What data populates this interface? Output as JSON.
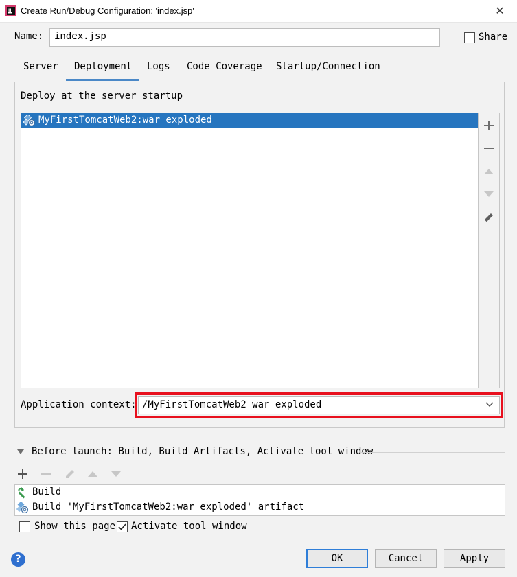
{
  "window": {
    "title": "Create Run/Debug Configuration: 'index.jsp'",
    "close_glyph": "✕"
  },
  "name_row": {
    "label": "Name:",
    "value": "index.jsp",
    "share_label": "Share",
    "share_checked": false
  },
  "tabs": [
    {
      "label": "Server",
      "active": false
    },
    {
      "label": "Deployment",
      "active": true
    },
    {
      "label": "Logs",
      "active": false
    },
    {
      "label": "Code Coverage",
      "active": false
    },
    {
      "label": "Startup/Connection",
      "active": false
    }
  ],
  "deployment": {
    "section_title": "Deploy at the server startup",
    "artifacts": [
      {
        "label": "MyFirstTomcatWeb2:war exploded",
        "icon": "war-artifact-icon",
        "selected": true
      }
    ],
    "toolbar": [
      "add-icon",
      "remove-icon",
      "move-up-icon",
      "move-down-icon",
      "edit-icon"
    ],
    "context_label": "Application context:",
    "context_value": "/MyFirstTomcatWeb2_war_exploded"
  },
  "before_launch": {
    "title": "Before launch: Build, Build Artifacts, Activate tool window",
    "items": [
      {
        "label": "Build",
        "icon": "hammer-icon"
      },
      {
        "label": "Build 'MyFirstTomcatWeb2:war exploded' artifact",
        "icon": "war-artifact-icon"
      }
    ],
    "show_page_label": "Show this page",
    "show_page_checked": false,
    "activate_label": "Activate tool window",
    "activate_checked": true
  },
  "buttons": {
    "help": "?",
    "ok": "OK",
    "cancel": "Cancel",
    "apply": "Apply"
  },
  "colors": {
    "selection": "#2675bf",
    "highlight_border": "#e8101e",
    "tab_underline": "#4a88c7"
  }
}
